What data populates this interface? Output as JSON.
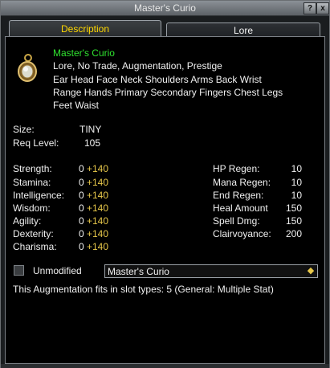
{
  "window": {
    "title": "Master's Curio",
    "help_label": "?",
    "close_label": "x"
  },
  "tabs": [
    {
      "label": "Description",
      "active": true
    },
    {
      "label": "Lore",
      "active": false
    }
  ],
  "item": {
    "name": "Master's Curio",
    "icon": "curio-amulet-icon",
    "flags": "Lore, No Trade, Augmentation, Prestige",
    "slots_line1": "Ear Head Face Neck Shoulders Arms Back Wrist",
    "slots_line2": "Range Hands Primary Secondary Fingers Chest Legs",
    "slots_line3": "Feet Waist",
    "size_label": "Size:",
    "size_value": "TINY",
    "req_label": "Req Level:",
    "req_value": "105"
  },
  "stats_left": [
    {
      "label": "Strength:",
      "base": "0",
      "bonus": "+140"
    },
    {
      "label": "Stamina:",
      "base": "0",
      "bonus": "+140"
    },
    {
      "label": "Intelligence:",
      "base": "0",
      "bonus": "+140"
    },
    {
      "label": "Wisdom:",
      "base": "0",
      "bonus": "+140"
    },
    {
      "label": "Agility:",
      "base": "0",
      "bonus": "+140"
    },
    {
      "label": "Dexterity:",
      "base": "0",
      "bonus": "+140"
    },
    {
      "label": "Charisma:",
      "base": "0",
      "bonus": "+140"
    }
  ],
  "stats_right": [
    {
      "label": "HP Regen:",
      "value": "10"
    },
    {
      "label": "Mana Regen:",
      "value": "10"
    },
    {
      "label": "End Regen:",
      "value": "10"
    },
    {
      "label": "Heal Amount",
      "value": "150"
    },
    {
      "label": "Spell Dmg:",
      "value": "150"
    },
    {
      "label": "Clairvoyance:",
      "value": "200"
    }
  ],
  "controls": {
    "unmodified_label": "Unmodified",
    "unmodified_checked": false,
    "variant_selected": "Master's Curio"
  },
  "footer": {
    "aug_text": "This Augmentation fits in slot types: 5 (General: Multiple Stat)"
  },
  "colors": {
    "name": "#2fe22f",
    "bonus": "#e8c84a",
    "active_tab": "#ffd800"
  }
}
